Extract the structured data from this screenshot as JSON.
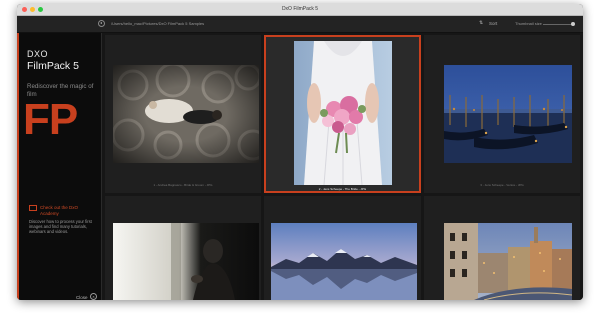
{
  "window": {
    "title": "DxO FilmPack 5"
  },
  "toolbar": {
    "path": "/Users/hello_mac/Pictures/DxO FilmPack 5 Samples",
    "sort_label": "Sort",
    "thumbnail_size_label": "Thumbnail size"
  },
  "sidebar": {
    "brand": "DXO",
    "product": "FilmPack 5",
    "tagline": "Rediscover the magic of film",
    "fp_mark": "FP",
    "tour_link": "Check out the DxO Academy",
    "tour_desc": "Discover how to process your first images and find many tutorials, webinars and videos.",
    "close_label": "Close"
  },
  "photos": [
    {
      "caption": "1 - Andrea Bagnasco - Bride & Groom - JPG",
      "selected": false
    },
    {
      "caption": "2 - Jens Scheepe - The Bride - JPG",
      "selected": true
    },
    {
      "caption": "3 - Jens Scheepe - Venice - JPG",
      "selected": false
    },
    {
      "caption": "",
      "selected": false
    },
    {
      "caption": "",
      "selected": false
    },
    {
      "caption": "",
      "selected": false
    }
  ],
  "colors": {
    "accent": "#c8401e",
    "sidebar_bg": "#0c0c0c",
    "grid_bg": "#161616"
  }
}
